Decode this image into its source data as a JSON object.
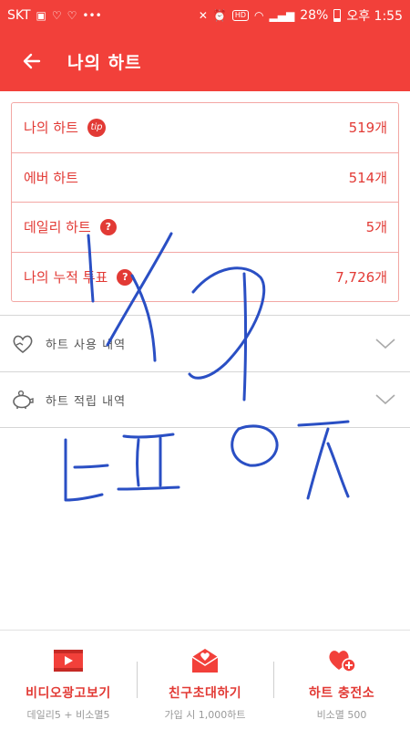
{
  "status_bar": {
    "carrier": "SKT",
    "battery": "28%",
    "time": "오후 1:55",
    "hd_label": "HD"
  },
  "app_bar": {
    "title": "나의 하트"
  },
  "summary": {
    "rows": [
      {
        "label": "나의 하트",
        "value": "519개",
        "badge": "tip"
      },
      {
        "label": "에버 하트",
        "value": "514개",
        "badge": ""
      },
      {
        "label": "데일리 하트",
        "value": "5개",
        "badge": "?"
      },
      {
        "label": "나의 누적 투표",
        "value": "7,726개",
        "badge": "?"
      }
    ]
  },
  "sections": {
    "usage_label": "하트 사용 내역",
    "earn_label": "하트 적립 내역"
  },
  "bottom_bar": {
    "items": [
      {
        "title": "비디오광고보기",
        "subtitle": "데일리5 + 비소멸5"
      },
      {
        "title": "친구초대하기",
        "subtitle": "가입 시 1,000하트"
      },
      {
        "title": "하트 충전소",
        "subtitle": "비소멸 500"
      }
    ]
  },
  "colors": {
    "accent": "#f2403a",
    "text_accent": "#e23a35",
    "border": "#f3a7a4",
    "ink": "#2a4fc4"
  },
  "icons": {
    "back": "arrow-left-icon",
    "usage": "heart-outline-icon",
    "earn": "piggy-bank-icon",
    "chevron": "chevron-down-icon",
    "video": "video-play-icon",
    "invite": "envelope-icon",
    "charge": "heart-plus-icon"
  }
}
